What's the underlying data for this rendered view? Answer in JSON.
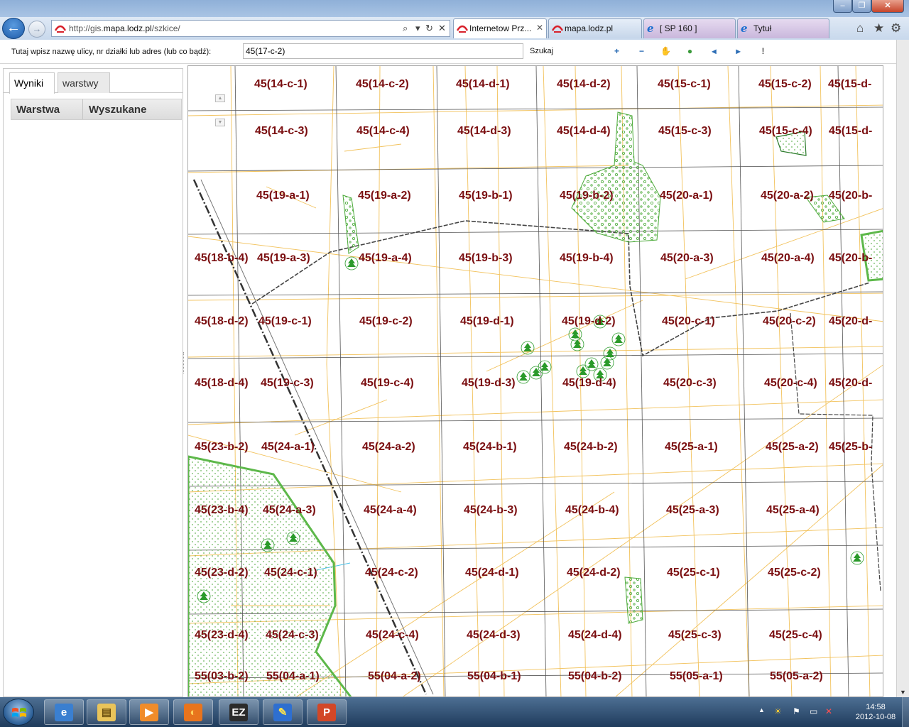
{
  "browser": {
    "address": {
      "prefix": "http://gis.",
      "host": "mapa.lodz.pl",
      "path": "/szkice/"
    },
    "tabs": [
      {
        "label": "Internetow Prz...",
        "active": true
      },
      {
        "label": "mapa.lodz.pl",
        "active": false
      },
      {
        "label": "[ SP 160 ]",
        "active": false
      },
      {
        "label": "Tytuł",
        "active": false
      }
    ],
    "back_glyph": "←",
    "forward_glyph": "→",
    "search_glyph": "⌕",
    "refresh_glyph": "↻",
    "stop_glyph": "✕",
    "home_glyph": "⌂",
    "favorites_glyph": "★",
    "tools_glyph": "⚙",
    "tab_close_glyph": "✕",
    "win_min": "–",
    "win_max": "❐",
    "win_close": "✕"
  },
  "search": {
    "label": "Tutaj wpisz nazwę ulicy, nr działki lub adres (lub co bądź):",
    "value": "45(17-c-2)",
    "button": "Szukaj"
  },
  "tools": [
    {
      "name": "zoom-in-icon",
      "glyph": "+",
      "color": "#2c6db5"
    },
    {
      "name": "zoom-out-icon",
      "glyph": "−",
      "color": "#2c6db5"
    },
    {
      "name": "pan-hand-icon",
      "glyph": "✋",
      "color": "#c9863a"
    },
    {
      "name": "full-extent-icon",
      "glyph": "●",
      "color": "#3a9a3a"
    },
    {
      "name": "zoom-previous-icon",
      "glyph": "◂",
      "color": "#2c6db5"
    },
    {
      "name": "zoom-next-icon",
      "glyph": "▸",
      "color": "#2c6db5"
    },
    {
      "name": "info-icon",
      "glyph": "!",
      "color": "#555555"
    }
  ],
  "sidebar": {
    "tabs": [
      "Wyniki",
      "warstwy"
    ],
    "columns": [
      "Warstwa",
      "Wyszukane"
    ]
  },
  "map": {
    "zoom_up": "▲",
    "zoom_down": "▼",
    "parcels": [
      "45(14-c-1)",
      "45(14-c-2)",
      "45(14-d-1)",
      "45(14-d-2)",
      "45(15-c-1)",
      "45(15-c-2)",
      "45(15-d-",
      "45(14-c-3)",
      "45(14-c-4)",
      "45(14-d-3)",
      "45(14-d-4)",
      "45(15-c-3)",
      "45(15-c-4)",
      "45(15-d-",
      "45(19-a-1)",
      "45(19-a-2)",
      "45(19-b-1)",
      "45(19-b-2)",
      "45(20-a-1)",
      "45(20-a-2)",
      "45(20-b-",
      "45(18-b-4)",
      "45(19-a-3)",
      "45(19-a-4)",
      "45(19-b-3)",
      "45(19-b-4)",
      "45(20-a-3)",
      "45(20-a-4)",
      "45(20-b-",
      "45(18-d-2)",
      "45(19-c-1)",
      "45(19-c-2)",
      "45(19-d-1)",
      "45(19-d-2)",
      "45(20-c-1)",
      "45(20-c-2)",
      "45(20-d-",
      "45(18-d-4)",
      "45(19-c-3)",
      "45(19-c-4)",
      "45(19-d-3)",
      "45(19-d-4)",
      "45(20-c-3)",
      "45(20-c-4)",
      "45(20-d-",
      "45(23-b-2)",
      "45(24-a-1)",
      "45(24-a-2)",
      "45(24-b-1)",
      "45(24-b-2)",
      "45(25-a-1)",
      "45(25-a-2)",
      "45(25-b-",
      "45(23-b-4)",
      "45(24-a-3)",
      "45(24-a-4)",
      "45(24-b-3)",
      "45(24-b-4)",
      "45(25-a-3)",
      "45(25-a-4)",
      "45(23-d-2)",
      "45(24-c-1)",
      "45(24-c-2)",
      "45(24-d-1)",
      "45(24-d-2)",
      "45(25-c-1)",
      "45(25-c-2)",
      "45(23-d-4)",
      "45(24-c-3)",
      "45(24-c-4)",
      "45(24-d-3)",
      "45(24-d-4)",
      "45(25-c-3)",
      "45(25-c-4)",
      "55(03-b-2)",
      "55(04-a-1)",
      "55(04-a-2)",
      "55(04-b-1)",
      "55(04-b-2)",
      "55(05-a-1)",
      "55(05-a-2)"
    ]
  },
  "taskbar": {
    "apps": [
      {
        "name": "internet-explorer-task",
        "glyph": "e",
        "bg": "#3a7fd0",
        "color": "#ffffff"
      },
      {
        "name": "explorer-folder-task",
        "glyph": "▤",
        "bg": "#e9c45a",
        "color": "#6b4f10"
      },
      {
        "name": "media-player-task",
        "glyph": "▶",
        "bg": "#f08c2a",
        "color": "#ffffff"
      },
      {
        "name": "firefox-task",
        "glyph": "◐",
        "bg": "#e8741d",
        "color": "#ffd25a"
      },
      {
        "name": "ez-app-task",
        "glyph": "EZ",
        "bg": "#2b2b2b",
        "color": "#ffffff"
      },
      {
        "name": "drawing-app-task",
        "glyph": "✎",
        "bg": "#2e6fd0",
        "color": "#ffe24a"
      },
      {
        "name": "powerpoint-task",
        "glyph": "P",
        "bg": "#d24726",
        "color": "#ffffff"
      }
    ],
    "tray": {
      "time": "14:58",
      "date": "2012-10-08",
      "chevron": "▲",
      "weather": "☀",
      "flag": "⚑",
      "network": "▭",
      "volume": "✕"
    }
  }
}
